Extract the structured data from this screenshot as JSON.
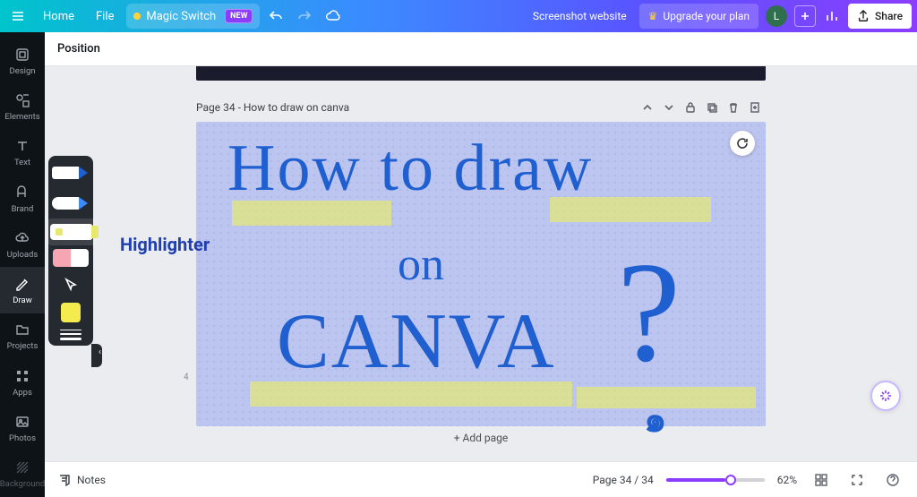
{
  "topbar": {
    "home": "Home",
    "file": "File",
    "magic_switch": "Magic Switch",
    "new_badge": "NEW",
    "doc_title": "Screenshot website",
    "upgrade": "Upgrade your plan",
    "avatar_initial": "L",
    "share": "Share"
  },
  "rail": {
    "items": [
      {
        "id": "design",
        "label": "Design"
      },
      {
        "id": "elements",
        "label": "Elements"
      },
      {
        "id": "text",
        "label": "Text"
      },
      {
        "id": "brand",
        "label": "Brand"
      },
      {
        "id": "uploads",
        "label": "Uploads"
      },
      {
        "id": "draw",
        "label": "Draw"
      },
      {
        "id": "projects",
        "label": "Projects"
      },
      {
        "id": "apps",
        "label": "Apps"
      },
      {
        "id": "photos",
        "label": "Photos"
      },
      {
        "id": "background",
        "label": "Background"
      }
    ],
    "active": "draw"
  },
  "context_toolbar": {
    "position": "Position"
  },
  "draw_panel": {
    "tools": [
      "pen",
      "marker",
      "highlighter",
      "eraser",
      "cursor",
      "color",
      "thickness"
    ],
    "selected_tool": "highlighter",
    "선택_color": "#f4ec4e",
    "tooltip_label": "Highlighter"
  },
  "page": {
    "header": "Page 34 - How to draw on canva",
    "handwriting_line1": "How to draw",
    "handwriting_line2": "on",
    "handwriting_line3": "CANVA",
    "question_mark": "?",
    "add_page": "+ Add page",
    "ruler_mark": "4"
  },
  "bottombar": {
    "notes": "Notes",
    "page_indicator": "Page 34 / 34",
    "zoom_pct": "62%"
  }
}
